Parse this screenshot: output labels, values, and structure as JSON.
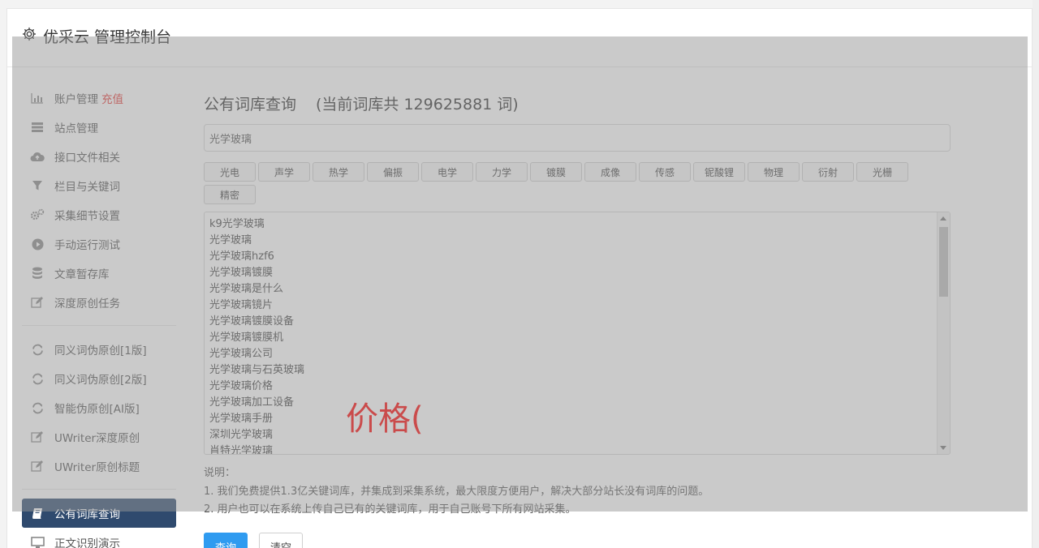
{
  "app": {
    "title": "优采云 管理控制台"
  },
  "sidebar": {
    "items": [
      {
        "name": "sidebar-item-account",
        "label": "账户管理",
        "extra": "充值",
        "icon": "bar-chart-icon"
      },
      {
        "name": "sidebar-item-sites",
        "label": "站点管理",
        "icon": "server-icon"
      },
      {
        "name": "sidebar-item-api-files",
        "label": "接口文件相关",
        "icon": "cloud-upload-icon"
      },
      {
        "name": "sidebar-item-columns-keywords",
        "label": "栏目与关键词",
        "icon": "filter-icon"
      },
      {
        "name": "sidebar-item-collect-settings",
        "label": "采集细节设置",
        "icon": "gears-icon"
      },
      {
        "name": "sidebar-item-manual-run",
        "label": "手动运行测试",
        "icon": "play-circle-icon"
      },
      {
        "name": "sidebar-item-article-storage",
        "label": "文章暂存库",
        "icon": "database-icon"
      },
      {
        "name": "sidebar-item-deep-original",
        "label": "深度原创任务",
        "icon": "edit-icon"
      }
    ],
    "items2": [
      {
        "name": "sidebar-item-synonym-v1",
        "label": "同义词伪原创[1版]",
        "icon": "refresh-icon"
      },
      {
        "name": "sidebar-item-synonym-v2",
        "label": "同义词伪原创[2版]",
        "icon": "refresh-icon"
      },
      {
        "name": "sidebar-item-ai-rewrite",
        "label": "智能伪原创[AI版]",
        "icon": "refresh-icon"
      },
      {
        "name": "sidebar-item-uwriter-deep",
        "label": "UWriter深度原创",
        "icon": "edit-icon"
      },
      {
        "name": "sidebar-item-uwriter-title",
        "label": "UWriter原创标题",
        "icon": "edit-icon"
      }
    ],
    "items3": [
      {
        "name": "sidebar-item-public-lexicon",
        "label": "公有词库查询",
        "icon": "book-icon",
        "active": true
      },
      {
        "name": "sidebar-item-text-recognition",
        "label": "正文识别演示",
        "icon": "monitor-icon"
      }
    ]
  },
  "main": {
    "title": "公有词库查询",
    "count_text": "(当前词库共 129625881 词)",
    "search_value": "光学玻璃",
    "tags": [
      "光电",
      "声学",
      "热学",
      "偏振",
      "电学",
      "力学",
      "镀膜",
      "成像",
      "传感",
      "铌酸锂",
      "物理",
      "衍射",
      "光栅",
      "精密"
    ],
    "results": [
      "k9光学玻璃",
      "光学玻璃",
      "光学玻璃hzf6",
      "光学玻璃镀膜",
      "光学玻璃是什么",
      "光学玻璃镜片",
      "光学玻璃镀膜设备",
      "光学玻璃镀膜机",
      "光学玻璃公司",
      "光学玻璃与石英玻璃",
      "光学玻璃价格",
      "光学玻璃加工设备",
      "光学玻璃手册",
      "深圳光学玻璃",
      "肖特光学玻璃"
    ],
    "overlay_text": "价格(",
    "notes_title": "说明：",
    "notes": [
      "1. 我们免费提供1.3亿关键词库，并集成到采集系统，最大限度方便用户，解决大部分站长没有词库的问题。",
      "2. 用户也可以在系统上传自己已有的关键词库，用于自己账号下所有网站采集。"
    ],
    "query_button": "查询",
    "clear_button": "清空"
  },
  "colors": {
    "active_nav": "#2f4a6e",
    "primary": "#2f9bf0",
    "highlight": "#ff0000",
    "recharge": "#e53935"
  }
}
